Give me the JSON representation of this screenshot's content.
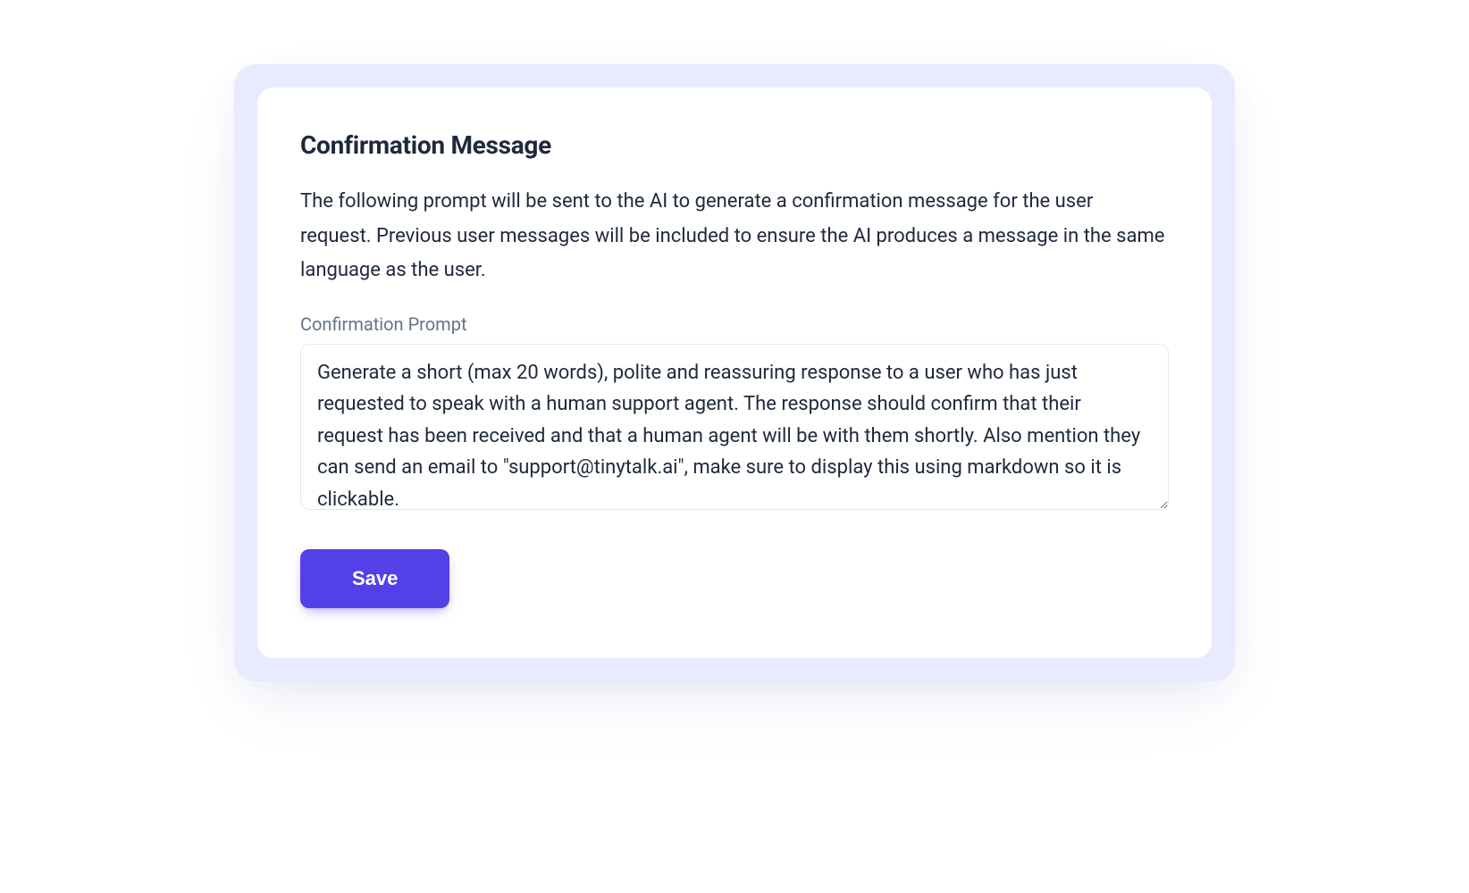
{
  "card": {
    "title": "Confirmation Message",
    "description": "The following prompt will be sent to the AI to generate a confirmation message for the user request. Previous user messages will be included to ensure the AI produces a message in the same language as the user.",
    "field_label": "Confirmation Prompt",
    "prompt_value": "Generate a short (max 20 words), polite and reassuring response to a user who has just requested to speak with a human support agent. The response should confirm that their request has been received and that a human agent will be with them shortly. Also mention they can send an email to \"support@tinytalk.ai\", make sure to display this using markdown so it is clickable.",
    "save_label": "Save"
  }
}
